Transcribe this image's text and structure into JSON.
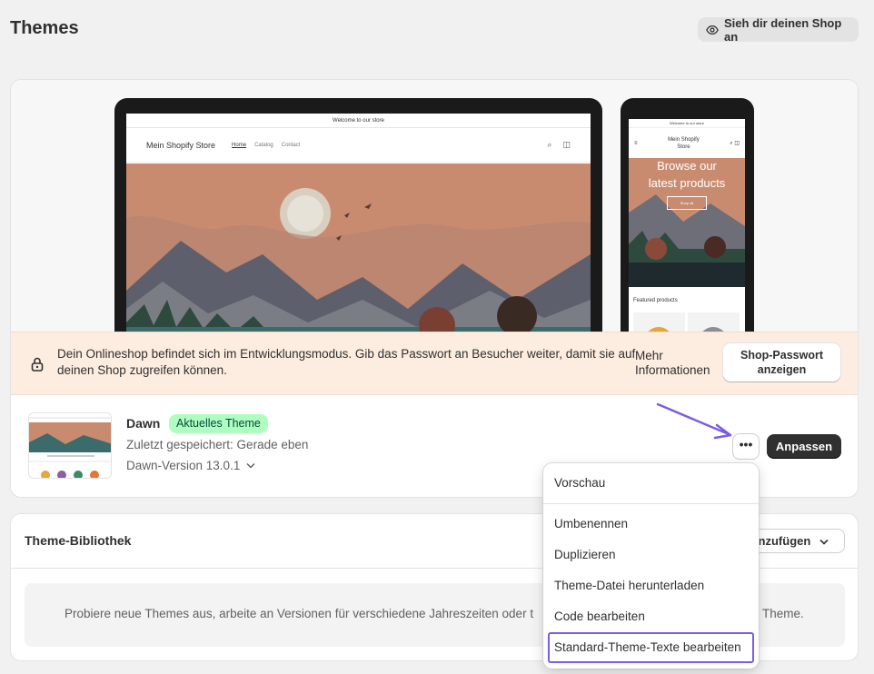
{
  "page": {
    "title": "Themes"
  },
  "header": {
    "view_store_label": "Sieh dir deinen Shop an"
  },
  "preview": {
    "announcement": "Welcome to our store",
    "store_name": "Mein Shopify Store",
    "nav": [
      "Home",
      "Catalog",
      "Contact"
    ],
    "hero_line1": "Browse our",
    "hero_line2": "latest products",
    "shop_all": "Shop all",
    "featured": "Featured products"
  },
  "dev_banner": {
    "message": "Dein Onlineshop befindet sich im Entwicklungsmodus. Gib das Passwort an Besucher weiter, damit sie auf deinen Shop zugreifen können.",
    "more_info_line1": "Mehr",
    "more_info_line2": "Informationen",
    "password_line1": "Shop-Passwort",
    "password_line2": "anzeigen"
  },
  "current_theme": {
    "name": "Dawn",
    "badge": "Aktuelles Theme",
    "last_saved": "Zuletzt gespeichert: Gerade eben",
    "version": "Dawn-Version 13.0.1",
    "more_actions": "•••",
    "customize_label": "Anpassen"
  },
  "library": {
    "title": "Theme-Bibliothek",
    "add_label": "hinzufügen",
    "empty_left": "Probiere neue Themes aus, arbeite an Versionen für verschiedene Jahreszeiten oder t",
    "empty_right": "Theme."
  },
  "dropdown": {
    "items": [
      "Vorschau",
      "Umbenennen",
      "Duplizieren",
      "Theme-Datei herunterladen",
      "Code bearbeiten",
      "Standard-Theme-Texte bearbeiten"
    ]
  },
  "colors": {
    "badge_bg": "#affebf",
    "banner_bg": "#fcede0",
    "highlight": "#7b5ce6",
    "primary_button": "#303030"
  }
}
